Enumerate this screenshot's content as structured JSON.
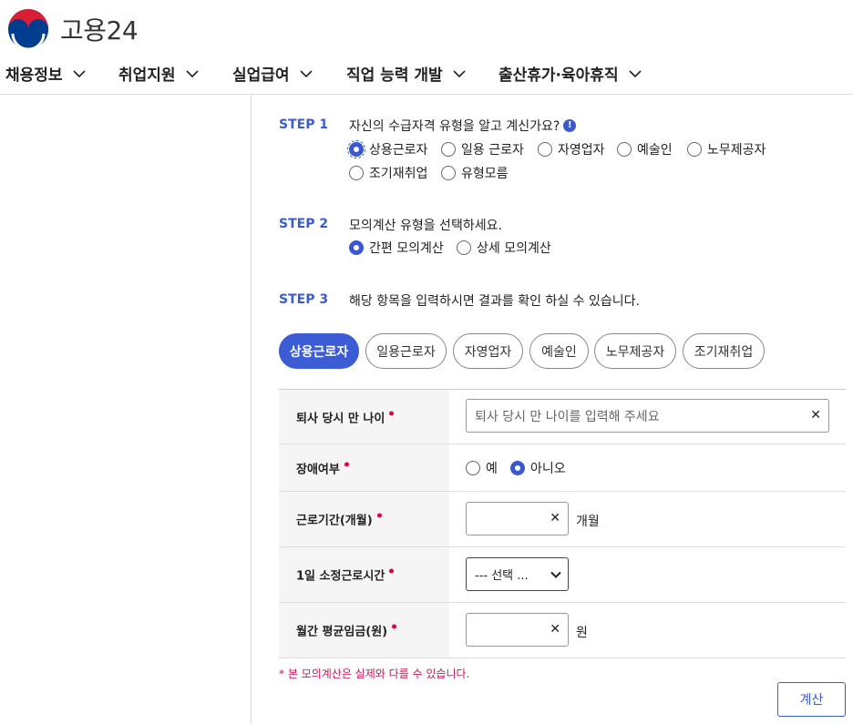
{
  "site": {
    "name": "고용24"
  },
  "nav": [
    {
      "label": "채용정보"
    },
    {
      "label": "취업지원"
    },
    {
      "label": "실업급여"
    },
    {
      "label": "직업 능력 개발"
    },
    {
      "label": "출산휴가·육아휴직"
    }
  ],
  "step1": {
    "label": "STEP 1",
    "question": "자신의 수급자격 유형을 알고 계신가요?",
    "options": [
      "상용근로자",
      "일용 근로자",
      "자영업자",
      "예술인",
      "노무제공자",
      "조기재취업",
      "유형모름"
    ],
    "selected": "상용근로자"
  },
  "step2": {
    "label": "STEP 2",
    "question": "모의계산 유형을 선택하세요.",
    "options": [
      "간편 모의계산",
      "상세 모의계산"
    ],
    "selected": "간편 모의계산"
  },
  "step3": {
    "label": "STEP 3",
    "question": "해당 항목을 입력하시면 결과를 확인 하실 수 있습니다."
  },
  "tabs": [
    {
      "label": "상용근로자",
      "active": true
    },
    {
      "label": "일용근로자"
    },
    {
      "label": "자영업자"
    },
    {
      "label": "예술인"
    },
    {
      "label": "노무제공자"
    },
    {
      "label": "조기재취업"
    }
  ],
  "form": {
    "age": {
      "label": "퇴사 당시 만 나이",
      "placeholder": "퇴사 당시 만 나이를 입력해 주세요",
      "value": ""
    },
    "disability": {
      "label": "장애여부",
      "options": [
        "예",
        "아니오"
      ],
      "selected": "아니오"
    },
    "period": {
      "label": "근로기간(개월)",
      "value": "",
      "unit": "개월"
    },
    "hours": {
      "label": "1일 소정근로시간",
      "selected": "--- 선택 ..."
    },
    "wage": {
      "label": "월간 평균임금(원)",
      "value": "",
      "unit": "원"
    }
  },
  "notice": "* 본 모의계산은 실제와 다를 수 있습니다.",
  "calculate_label": "계산",
  "colors": {
    "accent": "#3c5cd6",
    "required": "#e0004d",
    "notice": "#c2185b"
  }
}
